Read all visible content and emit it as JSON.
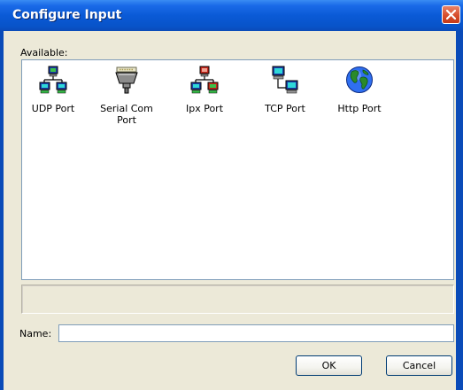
{
  "window": {
    "title": "Configure Input",
    "close_icon": "close-icon"
  },
  "list": {
    "label": "Available:",
    "items": [
      {
        "label": "UDP Port",
        "icon": "network-computers-icon"
      },
      {
        "label": "Serial Com Port",
        "icon": "serial-connector-icon"
      },
      {
        "label": "Ipx Port",
        "icon": "network-computers-icon"
      },
      {
        "label": "TCP Port",
        "icon": "tcp-computers-icon"
      },
      {
        "label": "Http Port",
        "icon": "globe-icon"
      }
    ]
  },
  "form": {
    "name_label": "Name:",
    "name_value": "",
    "name_placeholder": ""
  },
  "buttons": {
    "ok": "OK",
    "cancel": "Cancel"
  },
  "colors": {
    "titlebar": "#0a5ad6",
    "client": "#ece9d8",
    "close": "#d74d2b",
    "field_border": "#7f9db9"
  }
}
